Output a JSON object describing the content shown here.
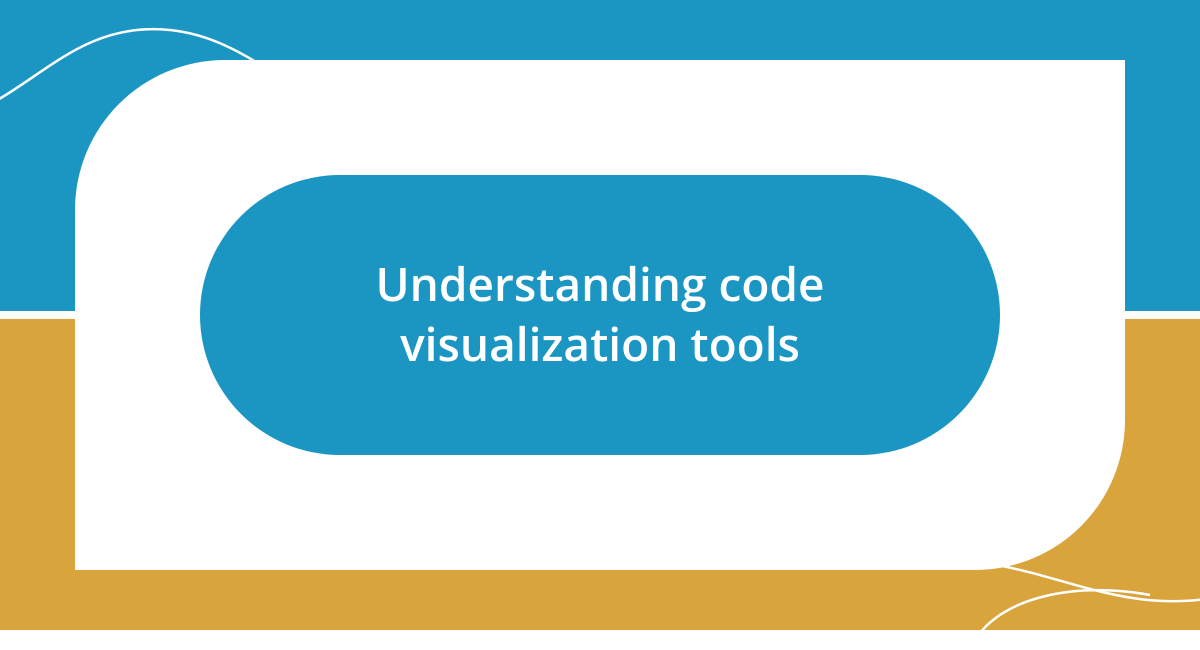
{
  "title": "Understanding code visualization tools",
  "colors": {
    "top_bg": "#1b96c3",
    "bottom_bg": "#d9a43b",
    "card": "#ffffff",
    "pill": "#1b96c3",
    "text": "#ffffff"
  }
}
